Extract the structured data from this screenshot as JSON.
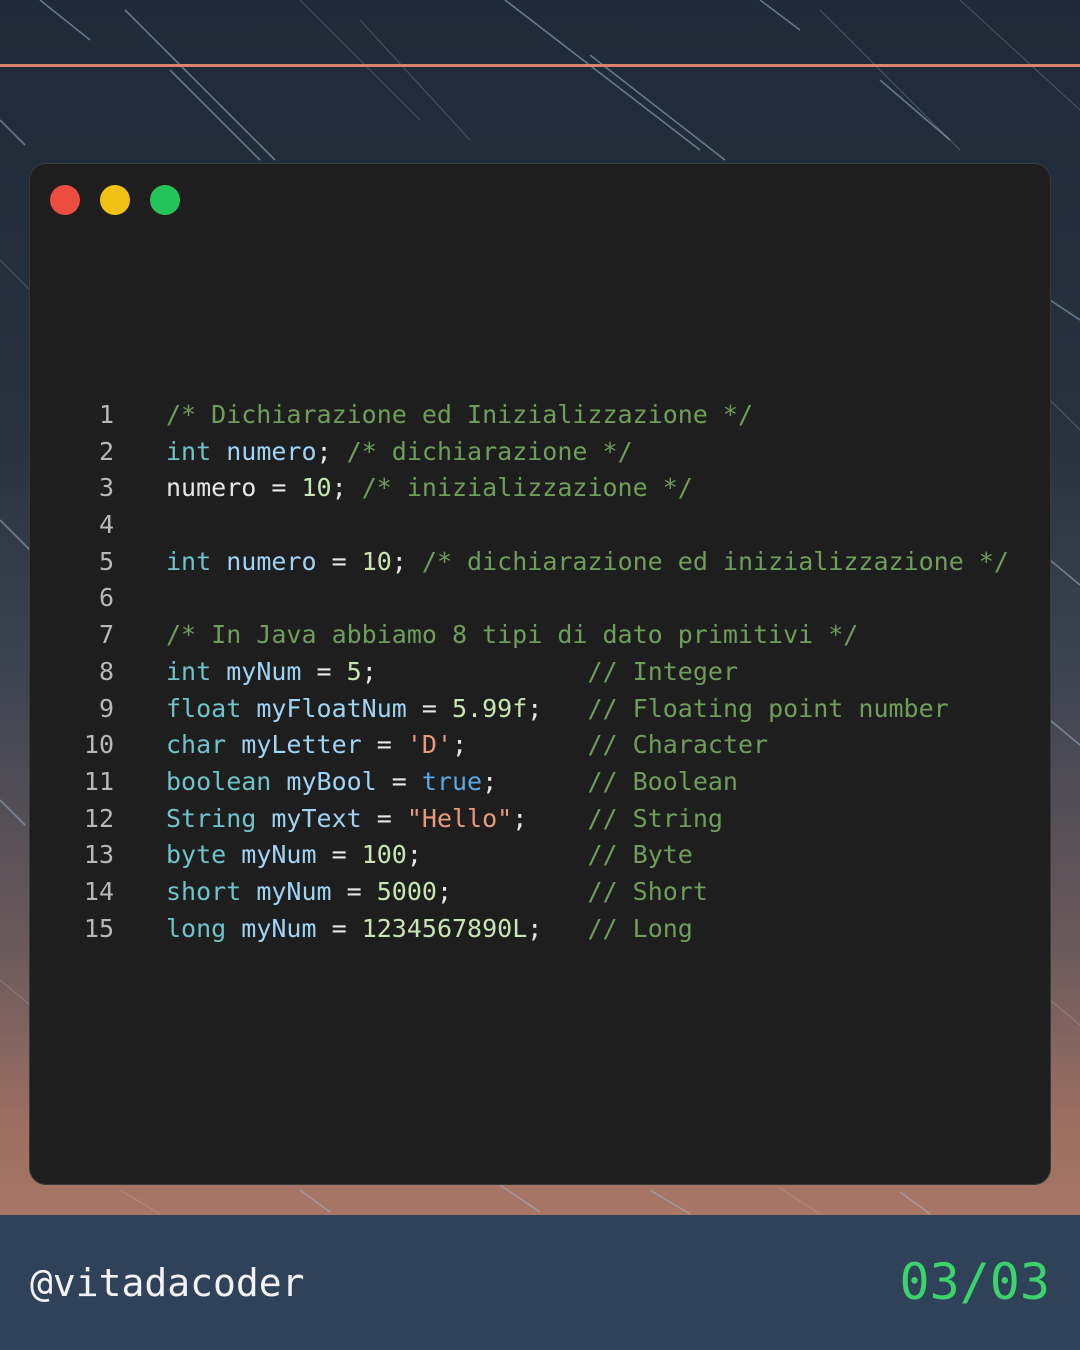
{
  "window": {
    "controls": [
      "close",
      "minimize",
      "maximize"
    ]
  },
  "code": {
    "lines": [
      {
        "n": "1",
        "tokens": [
          {
            "t": "/* Dichiarazione ed Inizializzazione */",
            "c": "comment"
          }
        ]
      },
      {
        "n": "2",
        "tokens": [
          {
            "t": "int",
            "c": "kw"
          },
          {
            "t": " ",
            "c": "plain"
          },
          {
            "t": "numero",
            "c": "var"
          },
          {
            "t": "; ",
            "c": "plain"
          },
          {
            "t": "/* dichiarazione */",
            "c": "comment"
          }
        ]
      },
      {
        "n": "3",
        "tokens": [
          {
            "t": "numero = ",
            "c": "plain"
          },
          {
            "t": "10",
            "c": "num"
          },
          {
            "t": "; ",
            "c": "plain"
          },
          {
            "t": "/* inizializzazione */",
            "c": "comment"
          }
        ]
      },
      {
        "n": "4",
        "tokens": []
      },
      {
        "n": "5",
        "tokens": [
          {
            "t": "int",
            "c": "kw"
          },
          {
            "t": " ",
            "c": "plain"
          },
          {
            "t": "numero",
            "c": "var"
          },
          {
            "t": " = ",
            "c": "plain"
          },
          {
            "t": "10",
            "c": "num"
          },
          {
            "t": "; ",
            "c": "plain"
          },
          {
            "t": "/* dichiarazione ed inizializzazione */",
            "c": "comment"
          }
        ]
      },
      {
        "n": "6",
        "tokens": []
      },
      {
        "n": "7",
        "tokens": [
          {
            "t": "/* In Java abbiamo 8 tipi di dato primitivi */",
            "c": "comment"
          }
        ]
      },
      {
        "n": "8",
        "tokens": [
          {
            "t": "int",
            "c": "kw"
          },
          {
            "t": " ",
            "c": "plain"
          },
          {
            "t": "myNum",
            "c": "var"
          },
          {
            "t": " = ",
            "c": "plain"
          },
          {
            "t": "5",
            "c": "num"
          },
          {
            "t": ";              ",
            "c": "plain"
          },
          {
            "t": "// Integer",
            "c": "comment"
          }
        ]
      },
      {
        "n": "9",
        "tokens": [
          {
            "t": "float",
            "c": "kw"
          },
          {
            "t": " ",
            "c": "plain"
          },
          {
            "t": "myFloatNum",
            "c": "var"
          },
          {
            "t": " = ",
            "c": "plain"
          },
          {
            "t": "5.99f",
            "c": "num"
          },
          {
            "t": ";   ",
            "c": "plain"
          },
          {
            "t": "// Floating point number",
            "c": "comment"
          }
        ]
      },
      {
        "n": "10",
        "tokens": [
          {
            "t": "char",
            "c": "kw"
          },
          {
            "t": " ",
            "c": "plain"
          },
          {
            "t": "myLetter",
            "c": "var"
          },
          {
            "t": " = ",
            "c": "plain"
          },
          {
            "t": "'D'",
            "c": "str"
          },
          {
            "t": ";        ",
            "c": "plain"
          },
          {
            "t": "// Character",
            "c": "comment"
          }
        ]
      },
      {
        "n": "11",
        "tokens": [
          {
            "t": "boolean",
            "c": "kw"
          },
          {
            "t": " ",
            "c": "plain"
          },
          {
            "t": "myBool",
            "c": "var"
          },
          {
            "t": " = ",
            "c": "plain"
          },
          {
            "t": "true",
            "c": "bool"
          },
          {
            "t": ";      ",
            "c": "plain"
          },
          {
            "t": "// Boolean",
            "c": "comment"
          }
        ]
      },
      {
        "n": "12",
        "tokens": [
          {
            "t": "String",
            "c": "kw"
          },
          {
            "t": " ",
            "c": "plain"
          },
          {
            "t": "myText",
            "c": "var"
          },
          {
            "t": " = ",
            "c": "plain"
          },
          {
            "t": "\"Hello\"",
            "c": "str"
          },
          {
            "t": ";    ",
            "c": "plain"
          },
          {
            "t": "// String",
            "c": "comment"
          }
        ]
      },
      {
        "n": "13",
        "tokens": [
          {
            "t": "byte",
            "c": "kw"
          },
          {
            "t": " ",
            "c": "plain"
          },
          {
            "t": "myNum",
            "c": "var"
          },
          {
            "t": " = ",
            "c": "plain"
          },
          {
            "t": "100",
            "c": "num"
          },
          {
            "t": ";           ",
            "c": "plain"
          },
          {
            "t": "// Byte",
            "c": "comment"
          }
        ]
      },
      {
        "n": "14",
        "tokens": [
          {
            "t": "short",
            "c": "kw"
          },
          {
            "t": " ",
            "c": "plain"
          },
          {
            "t": "myNum",
            "c": "var"
          },
          {
            "t": " = ",
            "c": "plain"
          },
          {
            "t": "5000",
            "c": "num"
          },
          {
            "t": ";         ",
            "c": "plain"
          },
          {
            "t": "// Short",
            "c": "comment"
          }
        ]
      },
      {
        "n": "15",
        "tokens": [
          {
            "t": "long",
            "c": "kw"
          },
          {
            "t": " ",
            "c": "plain"
          },
          {
            "t": "myNum",
            "c": "var"
          },
          {
            "t": " = ",
            "c": "plain"
          },
          {
            "t": "1234567890L",
            "c": "num"
          },
          {
            "t": ";   ",
            "c": "plain"
          },
          {
            "t": "// Long",
            "c": "comment"
          }
        ]
      }
    ]
  },
  "footer": {
    "handle": "@vitadacoder",
    "page": "03/03"
  },
  "colors": {
    "accent_rule": "#d9826f",
    "page_counter": "#3bd46a",
    "footer_bg": "#2f4259",
    "editor_bg": "#1e1e1e"
  }
}
